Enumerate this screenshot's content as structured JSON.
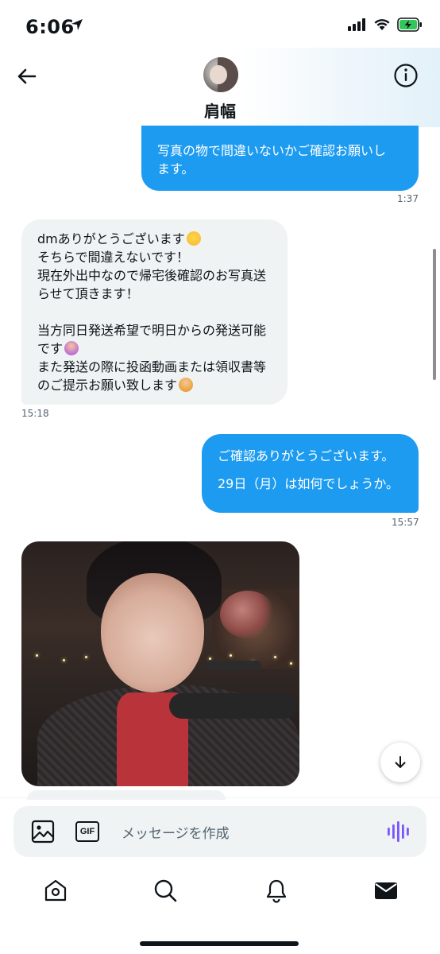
{
  "status_bar": {
    "time": "6:06",
    "icons": [
      "location-arrow-icon",
      "cellular-signal-icon",
      "wifi-icon",
      "battery-charging-icon"
    ]
  },
  "header": {
    "back_icon": "arrow-left-icon",
    "contact_name": "肩幅",
    "info_icon": "info-circle-icon"
  },
  "messages": [
    {
      "direction": "out",
      "lines": [
        "写真の物で間違いないかご確認お願いし",
        "ます。"
      ],
      "timestamp": "1:37"
    },
    {
      "direction": "in",
      "lines": [
        "dmありがとうございます",
        "そちらで間違えないです！",
        "現在外出中なので帰宅後確認のお写真送",
        "らせて頂きます！",
        "",
        "当方同日発送希望で明日からの発送可能",
        "です",
        "また発送の際に投函動画または領収書等",
        "のご提示お願い致します"
      ],
      "timestamp": "15:18"
    },
    {
      "direction": "out",
      "lines": [
        "ご確認ありがとうございます。",
        "",
        "29日（月）は如何でしょうか。"
      ],
      "timestamp": "15:57"
    },
    {
      "direction": "in",
      "type": "photo"
    }
  ],
  "composer": {
    "photo_icon": "image-icon",
    "gif_label": "GIF",
    "placeholder": "メッセージを作成",
    "voice_icon": "voice-waveform-icon"
  },
  "nav": {
    "items": [
      "home-icon",
      "search-icon",
      "notifications-bell-icon",
      "messages-envelope-icon"
    ],
    "active": "messages-envelope-icon"
  },
  "colors": {
    "outgoing_bubble": "#1d9bf0",
    "incoming_bubble": "#eff3f4",
    "voice_accent": "#7856ff",
    "battery_charging": "#33c759"
  }
}
